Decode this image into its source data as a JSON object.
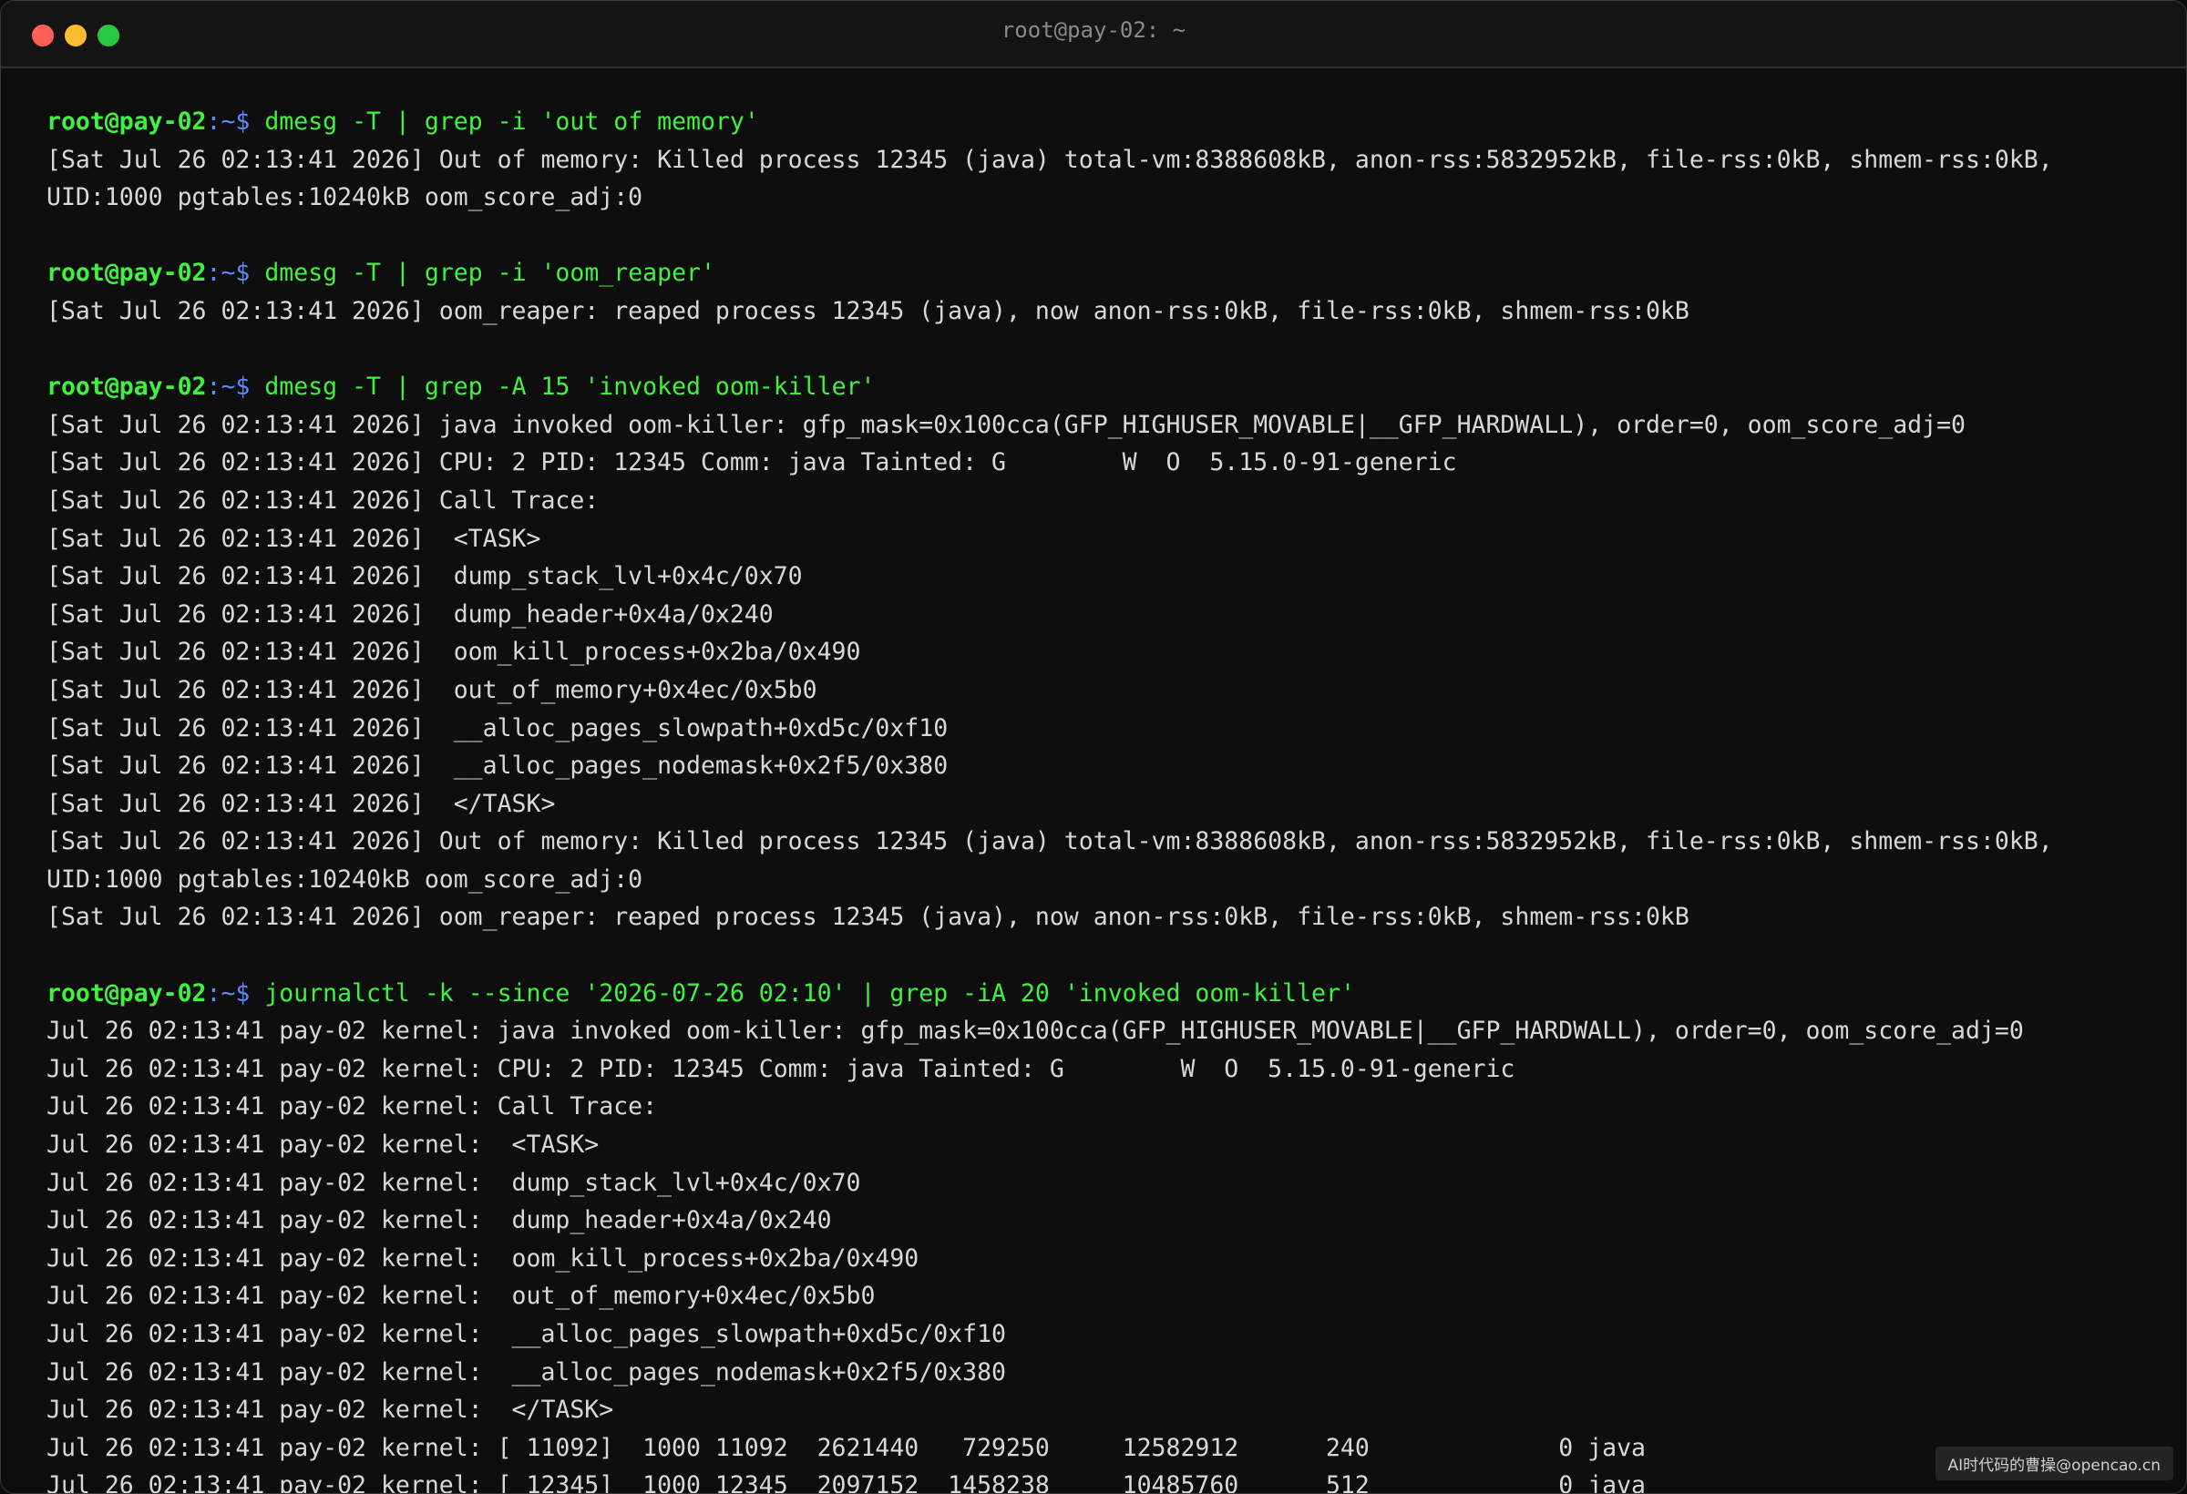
{
  "window": {
    "title": "root@pay-02: ~"
  },
  "prompt": {
    "user_host": "root@pay-02",
    "path": ":~",
    "symbol": "$ "
  },
  "blocks": [
    {
      "command": "dmesg -T | grep -i 'out of memory'",
      "output": [
        "[Sat Jul 26 02:13:41 2026] Out of memory: Killed process 12345 (java) total-vm:8388608kB, anon-rss:5832952kB, file-rss:0kB, shmem-rss:0kB,",
        "UID:1000 pgtables:10240kB oom_score_adj:0"
      ]
    },
    {
      "command": "dmesg -T | grep -i 'oom_reaper'",
      "output": [
        "[Sat Jul 26 02:13:41 2026] oom_reaper: reaped process 12345 (java), now anon-rss:0kB, file-rss:0kB, shmem-rss:0kB"
      ]
    },
    {
      "command": "dmesg -T | grep -A 15 'invoked oom-killer'",
      "output": [
        "[Sat Jul 26 02:13:41 2026] java invoked oom-killer: gfp_mask=0x100cca(GFP_HIGHUSER_MOVABLE|__GFP_HARDWALL), order=0, oom_score_adj=0",
        "[Sat Jul 26 02:13:41 2026] CPU: 2 PID: 12345 Comm: java Tainted: G        W  O  5.15.0-91-generic",
        "[Sat Jul 26 02:13:41 2026] Call Trace:",
        "[Sat Jul 26 02:13:41 2026]  <TASK>",
        "[Sat Jul 26 02:13:41 2026]  dump_stack_lvl+0x4c/0x70",
        "[Sat Jul 26 02:13:41 2026]  dump_header+0x4a/0x240",
        "[Sat Jul 26 02:13:41 2026]  oom_kill_process+0x2ba/0x490",
        "[Sat Jul 26 02:13:41 2026]  out_of_memory+0x4ec/0x5b0",
        "[Sat Jul 26 02:13:41 2026]  __alloc_pages_slowpath+0xd5c/0xf10",
        "[Sat Jul 26 02:13:41 2026]  __alloc_pages_nodemask+0x2f5/0x380",
        "[Sat Jul 26 02:13:41 2026]  </TASK>",
        "[Sat Jul 26 02:13:41 2026] Out of memory: Killed process 12345 (java) total-vm:8388608kB, anon-rss:5832952kB, file-rss:0kB, shmem-rss:0kB,",
        "UID:1000 pgtables:10240kB oom_score_adj:0",
        "[Sat Jul 26 02:13:41 2026] oom_reaper: reaped process 12345 (java), now anon-rss:0kB, file-rss:0kB, shmem-rss:0kB"
      ]
    },
    {
      "command": "journalctl -k --since '2026-07-26 02:10' | grep -iA 20 'invoked oom-killer'",
      "output": [
        "Jul 26 02:13:41 pay-02 kernel: java invoked oom-killer: gfp_mask=0x100cca(GFP_HIGHUSER_MOVABLE|__GFP_HARDWALL), order=0, oom_score_adj=0",
        "Jul 26 02:13:41 pay-02 kernel: CPU: 2 PID: 12345 Comm: java Tainted: G        W  O  5.15.0-91-generic",
        "Jul 26 02:13:41 pay-02 kernel: Call Trace:",
        "Jul 26 02:13:41 pay-02 kernel:  <TASK>",
        "Jul 26 02:13:41 pay-02 kernel:  dump_stack_lvl+0x4c/0x70",
        "Jul 26 02:13:41 pay-02 kernel:  dump_header+0x4a/0x240",
        "Jul 26 02:13:41 pay-02 kernel:  oom_kill_process+0x2ba/0x490",
        "Jul 26 02:13:41 pay-02 kernel:  out_of_memory+0x4ec/0x5b0",
        "Jul 26 02:13:41 pay-02 kernel:  __alloc_pages_slowpath+0xd5c/0xf10",
        "Jul 26 02:13:41 pay-02 kernel:  __alloc_pages_nodemask+0x2f5/0x380",
        "Jul 26 02:13:41 pay-02 kernel:  </TASK>",
        "Jul 26 02:13:41 pay-02 kernel: [ 11092]  1000 11092  2621440   729250     12582912      240             0 java",
        "Jul 26 02:13:41 pay-02 kernel: [ 12345]  1000 12345  2097152  1458238     10485760      512             0 java"
      ]
    }
  ],
  "watermark": "AI时代码的曹操@opencao.cn",
  "colors": {
    "background": "#0e0e0e",
    "prompt_user": "#3ef23e",
    "prompt_path": "#5a8cff",
    "command": "#3ef23e",
    "output": "#d8d8d8"
  }
}
